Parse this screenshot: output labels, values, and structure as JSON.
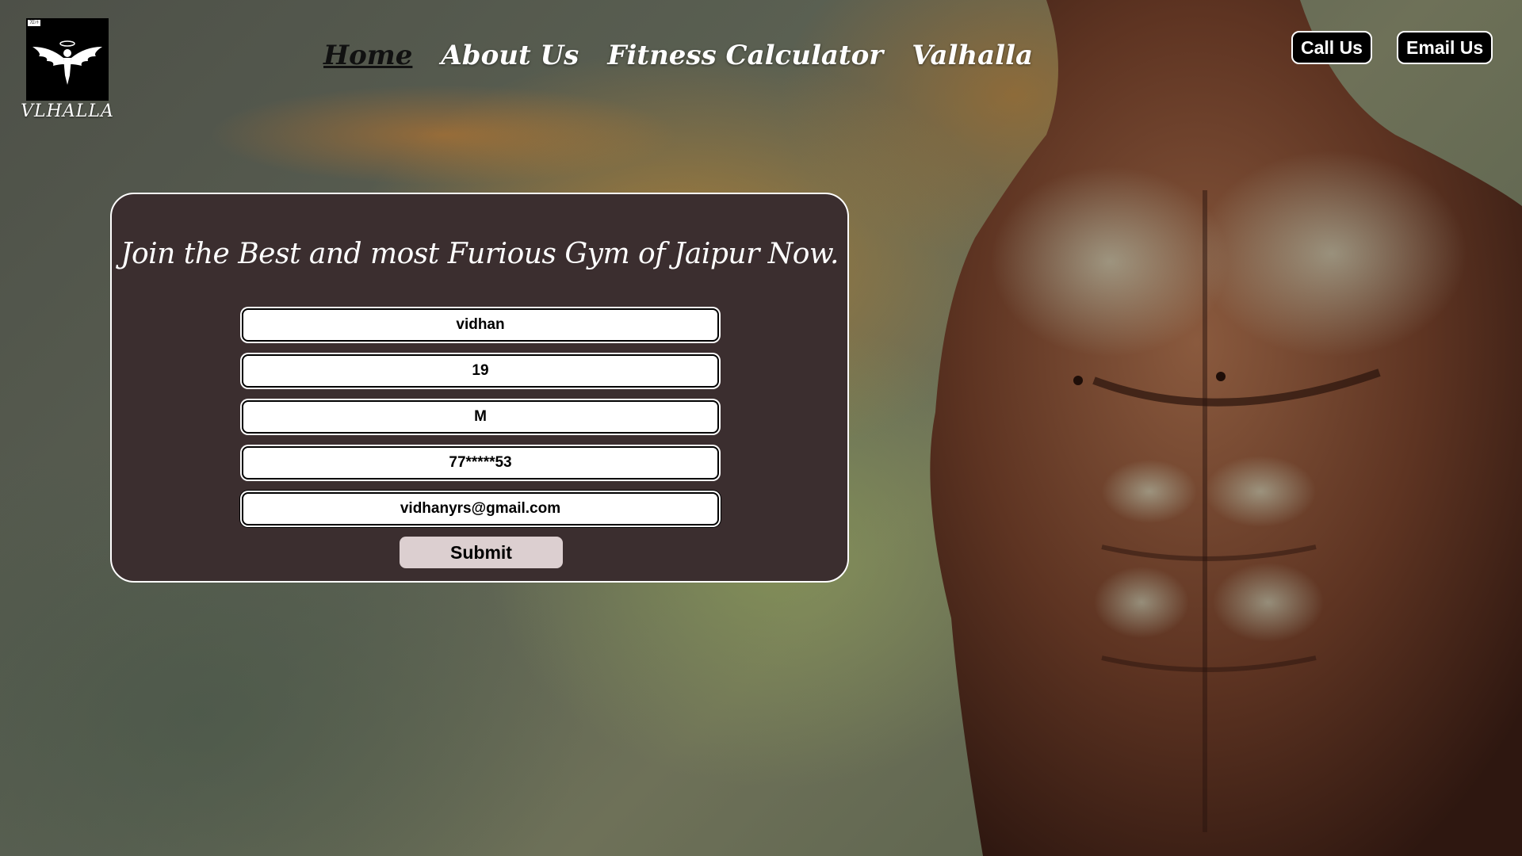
{
  "brand": {
    "logo_tag": "ﾌﾛﾝﾄ",
    "name": "VLHALLA"
  },
  "nav": {
    "items": [
      {
        "label": "Home",
        "active": true
      },
      {
        "label": "About Us",
        "active": false
      },
      {
        "label": "Fitness Calculator",
        "active": false
      },
      {
        "label": "Valhalla",
        "active": false
      }
    ]
  },
  "header": {
    "call_label": "Call Us",
    "email_label": "Email Us"
  },
  "form": {
    "title": "Join the Best and most Furious Gym of Jaipur Now.",
    "fields": {
      "name": "vidhan",
      "age": "19",
      "gender": "M",
      "phone": "77*****53",
      "email": "vidhanyrs@gmail.com"
    },
    "submit_label": "Submit"
  },
  "colors": {
    "card_bg": "#3b2e2f",
    "submit_bg": "#dccfd0",
    "header_button_bg": "#000000"
  }
}
